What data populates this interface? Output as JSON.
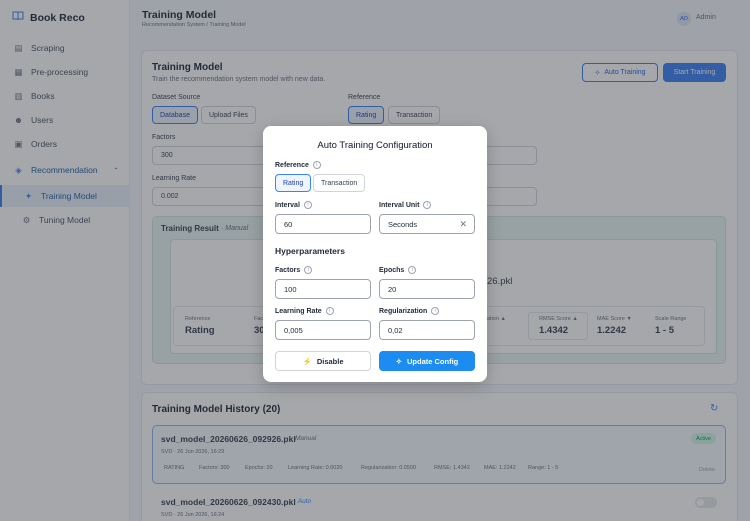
{
  "app": {
    "name": "Book Reco"
  },
  "sidebar": {
    "items": [
      {
        "label": "Scraping"
      },
      {
        "label": "Pre-processing"
      },
      {
        "label": "Books"
      },
      {
        "label": "Users"
      },
      {
        "label": "Orders"
      },
      {
        "label": "Recommendation"
      },
      {
        "label": "Training Model"
      },
      {
        "label": "Tuning Model"
      }
    ]
  },
  "header": {
    "title": "Training Model",
    "breadcrumb": "Recommendation System / Training Model",
    "avatar": "AD",
    "user": "Admin"
  },
  "main": {
    "title": "Training Model",
    "subtitle": "Train the recommendation system model with new data.",
    "auto_training_label": "Auto Training",
    "start_training_label": "Start Training",
    "dataset_source_label": "Dataset Source",
    "dataset_options": [
      "Database",
      "Upload Files"
    ],
    "reference_label": "Reference",
    "reference_options": [
      "Rating",
      "Transaction"
    ],
    "factors_label": "Factors",
    "factors_value": "300",
    "learning_rate_label": "Learning Rate",
    "learning_rate_value": "0.002",
    "result_title": "Training Result",
    "result_mode": "· Manual",
    "result_file": "26.pkl",
    "stats": {
      "reference_label": "Reference",
      "reference_value": "Rating",
      "factors_label": "Fac",
      "factors_value": "30",
      "rmse_label": "RMSE Score ▲",
      "rmse_value": "1.4342",
      "mae_label": "MAE Score ▼",
      "mae_value": "1.2242",
      "scale_label": "Scale Range",
      "scale_value": "1 - 5",
      "partial_label": "ation ▲"
    }
  },
  "history": {
    "title": "Training Model History (20)",
    "rows": [
      {
        "name": "svd_model_20260626_092926.pkl",
        "mode": "· Manual",
        "meta": "SVD · 26 Jun 2026, 16:29",
        "status": "Active",
        "details": [
          "RATING",
          "Factors: 300",
          "Epochs: 20",
          "Learning Rate: 0.0020",
          "Regularization: 0.0500",
          "RMSE: 1.4342",
          "MAE: 1.2242",
          "Range: 1 - 5"
        ],
        "action": "Delete"
      },
      {
        "name": "svd_model_20260626_092430.pkl",
        "mode": "· Auto",
        "meta": "SVD · 26 Jun 2026, 16:24"
      }
    ]
  },
  "modal": {
    "title": "Auto Training Configuration",
    "reference_label": "Reference",
    "reference_options": [
      "Rating",
      "Transaction"
    ],
    "interval_label": "Interval",
    "interval_value": "60",
    "interval_unit_label": "Interval Unit",
    "interval_unit_value": "Seconds",
    "hyperparameters_label": "Hyperparameters",
    "factors_label": "Factors",
    "factors_value": "100",
    "epochs_label": "Epochs",
    "epochs_value": "20",
    "learning_rate_label": "Learning Rate",
    "learning_rate_value": "0,005",
    "regularization_label": "Regularization",
    "regularization_value": "0,02",
    "disable_label": "Disable",
    "update_label": "Update Config"
  },
  "colors": {
    "accent": "#3b82f6",
    "overlay": "rgba(40,45,55,0.42)",
    "result_bg": "#e9f5f1"
  }
}
